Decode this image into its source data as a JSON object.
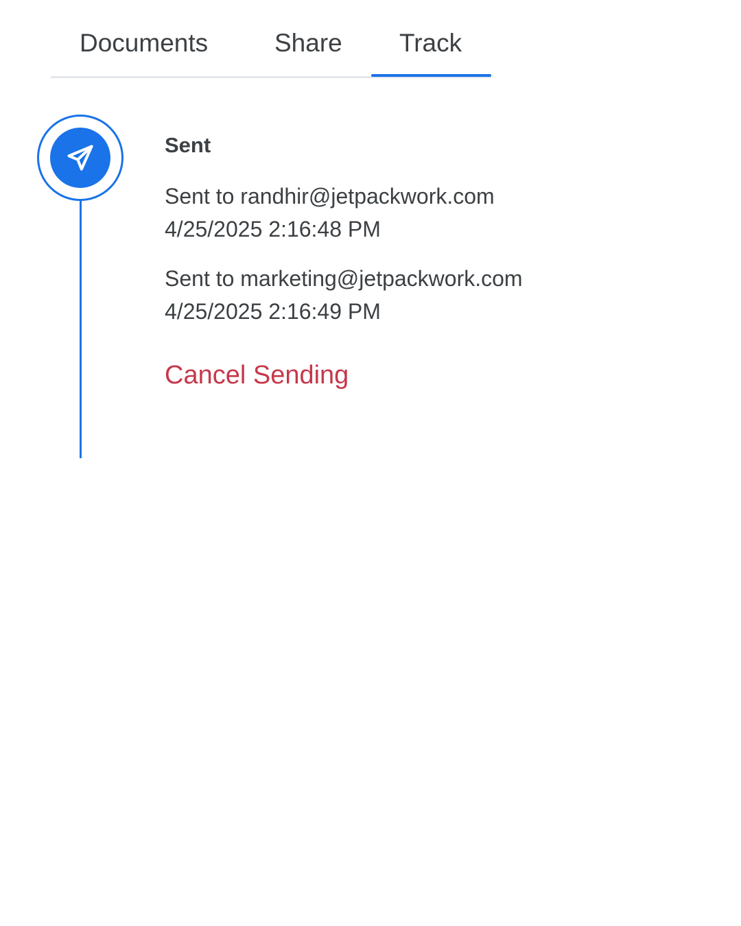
{
  "tabs": [
    {
      "label": "Documents",
      "active": false
    },
    {
      "label": "Share",
      "active": false
    },
    {
      "label": "Track",
      "active": true
    }
  ],
  "colors": {
    "accent": "#1a73e8",
    "danger": "#c5384b",
    "text": "#3c4043",
    "divider": "#e3e6ec"
  },
  "timeline": {
    "status": {
      "icon": "paper-plane-icon",
      "title": "Sent"
    },
    "events": [
      {
        "text": "Sent to randhir@jetpackwork.com",
        "timestamp": "4/25/2025 2:16:48 PM"
      },
      {
        "text": "Sent to marketing@jetpackwork.com",
        "timestamp": "4/25/2025 2:16:49 PM"
      }
    ],
    "cancel_label": "Cancel Sending"
  }
}
